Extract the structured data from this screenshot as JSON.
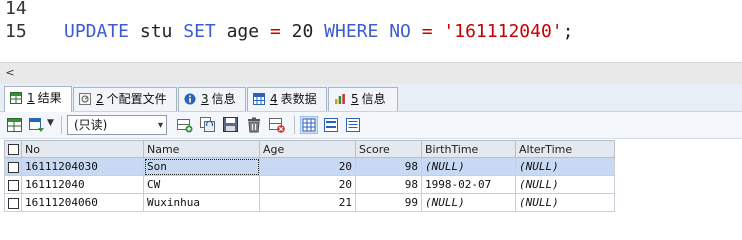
{
  "editor": {
    "line_numbers": [
      "14",
      "15"
    ],
    "code": {
      "kw_update": "UPDATE",
      "table": "stu",
      "kw_set": "SET",
      "col_age": "age",
      "eq1": "=",
      "age_value": "20",
      "kw_where": "WHERE",
      "col_no": "NO",
      "eq2": "=",
      "no_value": "'161112040'",
      "semicolon": ";"
    }
  },
  "scrollbar": {
    "left_arrow": "<"
  },
  "tabs": [
    {
      "num": "1",
      "label": "结果",
      "icon": "grid-result-icon"
    },
    {
      "num": "2",
      "label": "个配置文件",
      "icon": "profile-icon"
    },
    {
      "num": "3",
      "label": "信息",
      "icon": "info-icon"
    },
    {
      "num": "4",
      "label": "表数据",
      "icon": "table-data-icon"
    },
    {
      "num": "5",
      "label": "信息",
      "icon": "chart-info-icon"
    }
  ],
  "toolbar": {
    "readonly_select": "(只读)"
  },
  "grid": {
    "columns": [
      "No",
      "Name",
      "Age",
      "Score",
      "BirthTime",
      "AlterTime"
    ],
    "rows": [
      {
        "no": "16111204030",
        "name": "Son",
        "age": "20",
        "score": "98",
        "birth": "(NULL)",
        "alter": "(NULL)"
      },
      {
        "no": "161112040",
        "name": "CW",
        "age": "20",
        "score": "98",
        "birth": "1998-02-07",
        "alter": "(NULL)"
      },
      {
        "no": "16111204060",
        "name": "Wuxinhua",
        "age": "21",
        "score": "99",
        "birth": "(NULL)",
        "alter": "(NULL)"
      }
    ]
  },
  "colors": {
    "keyword": "#3c5ccf",
    "string": "#c80000",
    "selected_row": "#c8d9f4"
  }
}
